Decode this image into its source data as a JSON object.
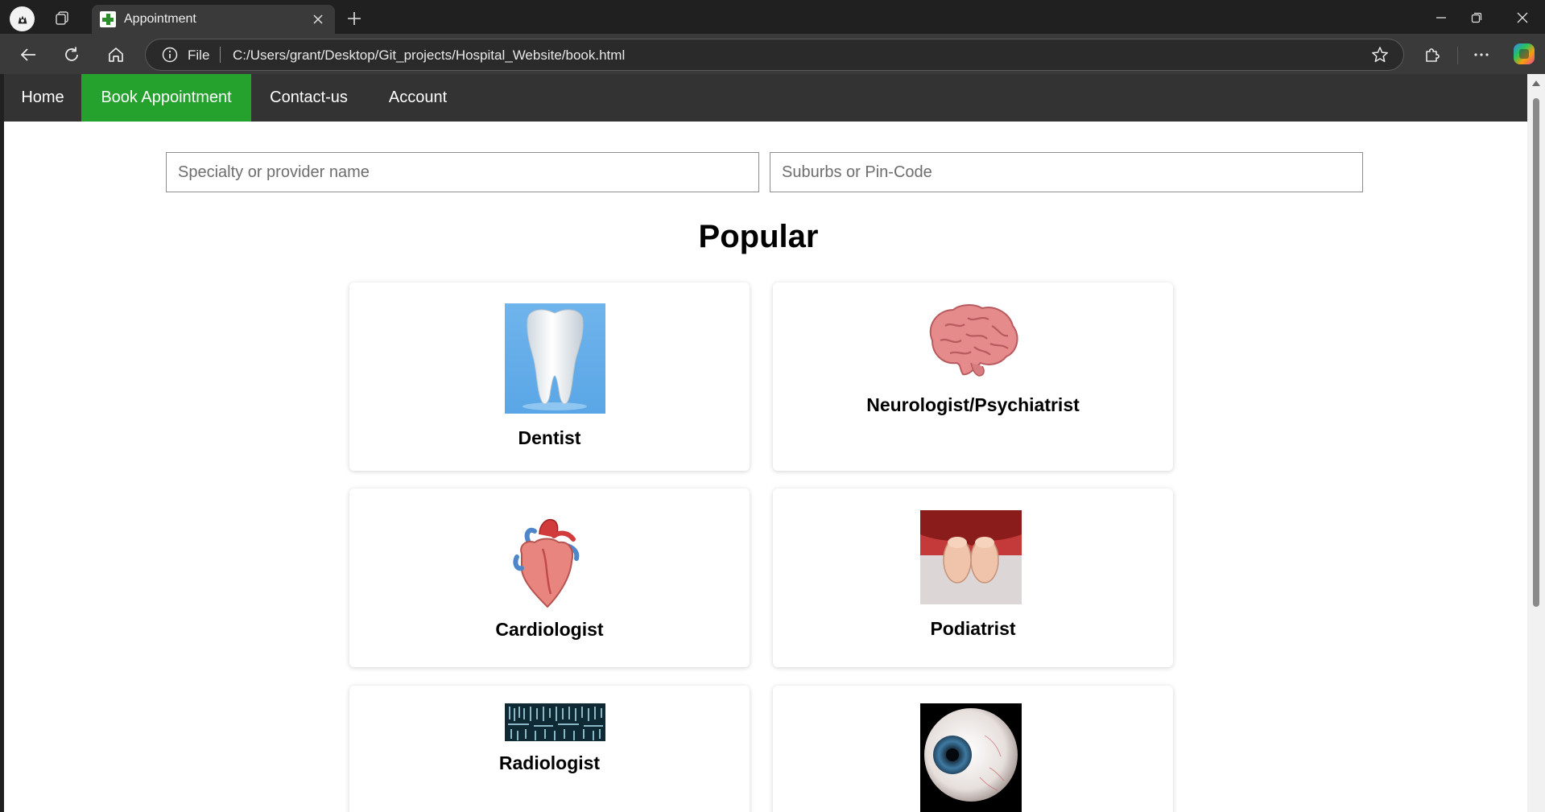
{
  "browser": {
    "tab_title": "Appointment",
    "address_scheme_label": "File",
    "url": "C:/Users/grant/Desktop/Git_projects/Hospital_Website/book.html"
  },
  "site_nav": {
    "items": [
      {
        "label": "Home",
        "active": false
      },
      {
        "label": "Book Appointment",
        "active": true
      },
      {
        "label": "Contact-us",
        "active": false
      },
      {
        "label": "Account",
        "active": false
      }
    ],
    "active_color": "#25a22e",
    "bar_color": "#333333"
  },
  "search": {
    "specialty_placeholder": "Specialty or provider name",
    "location_placeholder": "Suburbs or Pin-Code"
  },
  "popular": {
    "title": "Popular",
    "cards": [
      {
        "label": "Dentist",
        "icon": "tooth-image"
      },
      {
        "label": "Neurologist/Psychiatrist",
        "icon": "brain-image"
      },
      {
        "label": "Cardiologist",
        "icon": "heart-image"
      },
      {
        "label": "Podiatrist",
        "icon": "feet-image"
      },
      {
        "label": "Radiologist",
        "icon": "xray-image"
      },
      {
        "label": "",
        "icon": "eye-image"
      }
    ]
  }
}
